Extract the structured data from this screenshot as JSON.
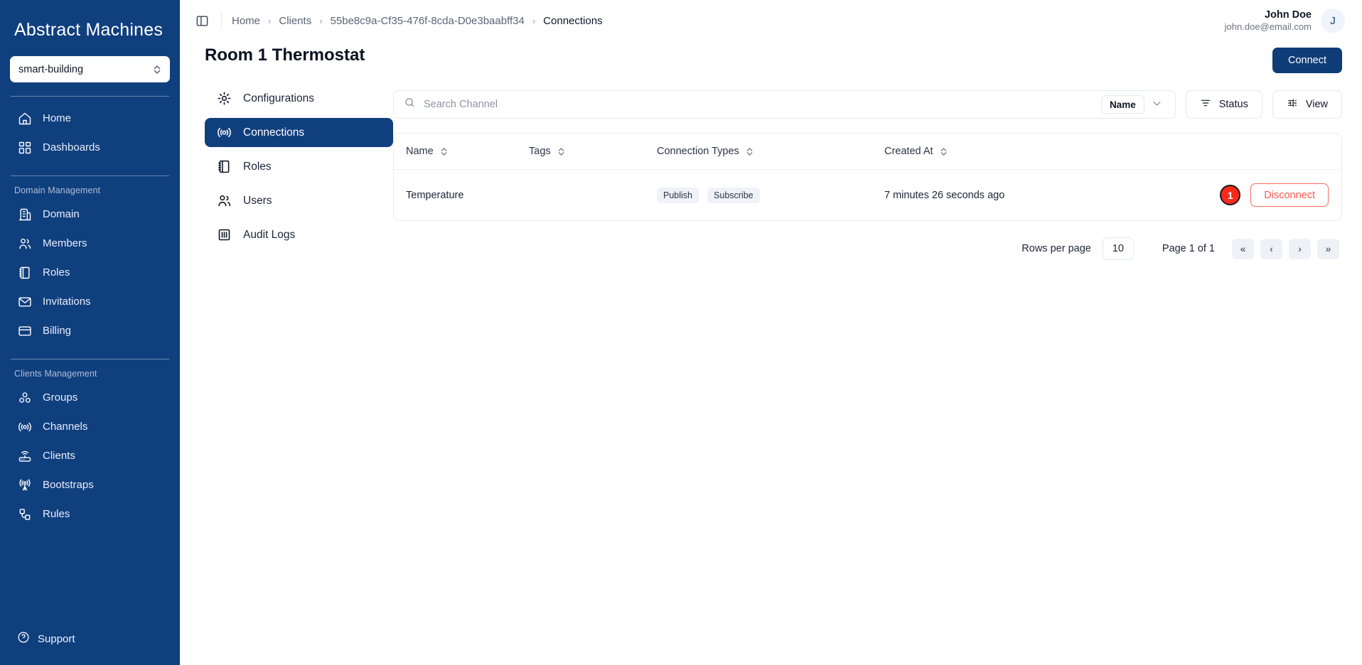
{
  "sidebar": {
    "brand": "Abstract Machines",
    "domain_selector": {
      "value": "smart-building",
      "icon": "chevron-updown-icon"
    },
    "primary_items": [
      {
        "label": "Home",
        "icon": "home-icon"
      },
      {
        "label": "Dashboards",
        "icon": "dashboards-icon"
      }
    ],
    "sections": [
      {
        "title": "Domain Management",
        "items": [
          {
            "label": "Domain",
            "icon": "building-icon"
          },
          {
            "label": "Members",
            "icon": "users-icon"
          },
          {
            "label": "Roles",
            "icon": "book-icon"
          },
          {
            "label": "Invitations",
            "icon": "mail-icon"
          },
          {
            "label": "Billing",
            "icon": "card-icon"
          }
        ]
      },
      {
        "title": "Clients Management",
        "items": [
          {
            "label": "Groups",
            "icon": "groups-icon"
          },
          {
            "label": "Channels",
            "icon": "broadcast-icon"
          },
          {
            "label": "Clients",
            "icon": "router-icon"
          },
          {
            "label": "Bootstraps",
            "icon": "antenna-icon"
          },
          {
            "label": "Rules",
            "icon": "rules-icon"
          }
        ]
      }
    ],
    "support": {
      "label": "Support",
      "icon": "help-circle-icon"
    }
  },
  "topbar": {
    "panel_toggle_icon": "sidebar-toggle-icon",
    "breadcrumb": [
      {
        "label": "Home",
        "current": false
      },
      {
        "label": "Clients",
        "current": false
      },
      {
        "label": "55be8c9a-Cf35-476f-8cda-D0e3baabff34",
        "current": false
      },
      {
        "label": "Connections",
        "current": true
      }
    ],
    "separator": "›",
    "user": {
      "name": "John Doe",
      "email": "john.doe@email.com",
      "initial": "J"
    }
  },
  "page": {
    "title": "Room 1 Thermostat"
  },
  "subnav": {
    "items": [
      {
        "label": "Configurations",
        "icon": "gear-icon",
        "active": false
      },
      {
        "label": "Connections",
        "icon": "broadcast-icon",
        "active": true
      },
      {
        "label": "Roles",
        "icon": "book-icon",
        "active": false
      },
      {
        "label": "Users",
        "icon": "users-icon",
        "active": false
      },
      {
        "label": "Audit Logs",
        "icon": "audit-logs-icon",
        "active": false
      }
    ]
  },
  "toolbar": {
    "connect_label": "Connect",
    "search": {
      "placeholder": "Search Channel",
      "value": "",
      "icon": "search-icon"
    },
    "search_field": {
      "label": "Name",
      "caret": "∨"
    },
    "status_button": {
      "label": "Status",
      "icon": "filter-icon"
    },
    "view_button": {
      "label": "View",
      "icon": "sliders-icon"
    }
  },
  "table": {
    "columns": [
      {
        "label": "Name",
        "sortable": true
      },
      {
        "label": "Tags",
        "sortable": true
      },
      {
        "label": "Connection Types",
        "sortable": true
      },
      {
        "label": "Created At",
        "sortable": true
      },
      {
        "label": "",
        "sortable": false
      }
    ],
    "rows": [
      {
        "name": "Temperature",
        "tags": "",
        "connection_types": [
          "Publish",
          "Subscribe"
        ],
        "created_at": "7 minutes 26 seconds ago",
        "marker": "1",
        "action_label": "Disconnect"
      }
    ]
  },
  "pagination": {
    "rows_per_page_label": "Rows per page",
    "rows_per_page_value": "10",
    "page_label": "Page 1 of 1",
    "buttons": [
      {
        "glyph": "«",
        "name": "first-page"
      },
      {
        "glyph": "‹",
        "name": "prev-page"
      },
      {
        "glyph": "›",
        "name": "next-page"
      },
      {
        "glyph": "»",
        "name": "last-page"
      }
    ]
  },
  "colors": {
    "brand_blue": "#103f7e",
    "primary_button": "#0e3d78",
    "danger": "#f9574b",
    "marker_red": "#f92a1c",
    "chip_bg": "#eff2f8"
  }
}
